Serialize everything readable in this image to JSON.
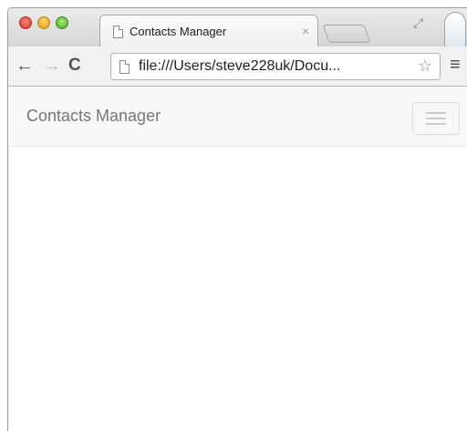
{
  "browser": {
    "tab": {
      "title": "Contacts Manager",
      "close_label": "×"
    },
    "toolbar": {
      "back_icon": "←",
      "forward_icon": "→",
      "reload_icon": "C",
      "url": "file:///Users/steve228uk/Docu...",
      "star_icon": "☆",
      "menu_icon": "≡"
    },
    "icons": {
      "fullscreen": "fullscreen-icon",
      "profile": "profile-icon"
    }
  },
  "app": {
    "navbar": {
      "brand": "Contacts Manager"
    }
  },
  "colors": {
    "navbar_bg": "#f8f8f8",
    "brand_text": "#777777",
    "toggle_bar": "#cccccc"
  }
}
